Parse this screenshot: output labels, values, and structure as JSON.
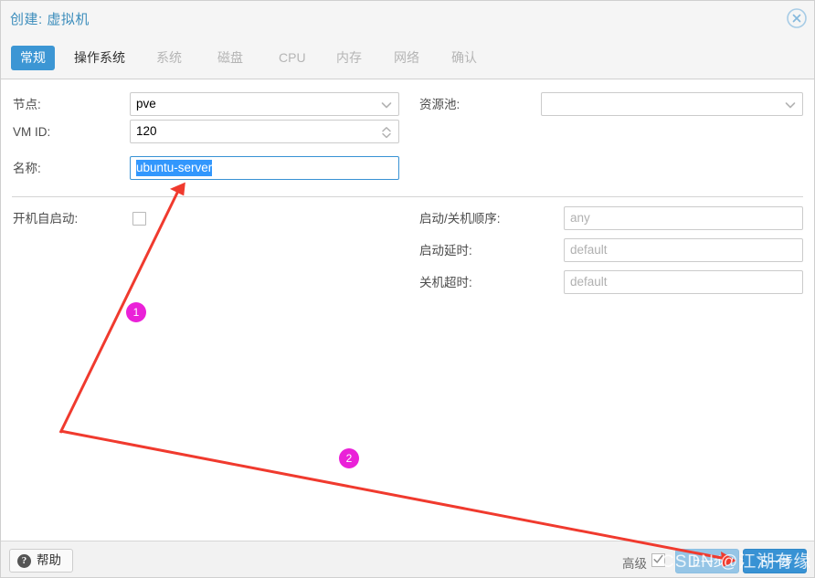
{
  "window": {
    "title": "创建: 虚拟机",
    "close_icon": "close-circle-icon"
  },
  "tabs": [
    {
      "label": "常规",
      "state": "active"
    },
    {
      "label": "操作系统",
      "state": "enabled"
    },
    {
      "label": "系统",
      "state": "disabled"
    },
    {
      "label": "磁盘",
      "state": "disabled"
    },
    {
      "label": "CPU",
      "state": "disabled"
    },
    {
      "label": "内存",
      "state": "disabled"
    },
    {
      "label": "网络",
      "state": "disabled"
    },
    {
      "label": "确认",
      "state": "disabled"
    }
  ],
  "form": {
    "left": {
      "node": {
        "label": "节点:",
        "value": "pve",
        "control": "combobox"
      },
      "vmid": {
        "label": "VM ID:",
        "value": "120",
        "control": "spinner"
      },
      "name": {
        "label": "名称:",
        "value": "ubuntu-server",
        "control": "textfield",
        "focused": true,
        "selected": true
      },
      "start_at_boot": {
        "label": "开机自启动:",
        "checked": false,
        "control": "checkbox"
      }
    },
    "right": {
      "pool": {
        "label": "资源池:",
        "value": "",
        "control": "combobox"
      },
      "start_order": {
        "label": "启动/关机顺序:",
        "value": "",
        "placeholder": "any",
        "control": "textfield"
      },
      "startup_delay": {
        "label": "启动延时:",
        "value": "",
        "placeholder": "default",
        "control": "textfield"
      },
      "shutdown_timeout": {
        "label": "关机超时:",
        "value": "",
        "placeholder": "default",
        "control": "textfield"
      }
    }
  },
  "footer": {
    "help_label": "帮助",
    "help_icon": "question-circle-icon",
    "advanced_label": "高级",
    "advanced_checked": true,
    "back_label": "上一步",
    "next_label": "下一步"
  },
  "annotations": {
    "badge1": "1",
    "badge2": "2",
    "arrow_color": "#f03a2e",
    "badge_color": "#ea21d8"
  },
  "watermark": {
    "text": "CSDN @江湖有缘"
  }
}
